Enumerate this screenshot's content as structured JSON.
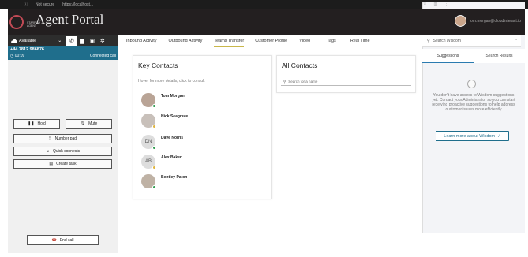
{
  "browser": {
    "security_label": "Not secure",
    "url": "https://localhost..."
  },
  "header": {
    "logo_small": "STARFISH AGENT",
    "title": "Agent Portal",
    "user_email": "tom.morgan@cloudinteract.io"
  },
  "agent": {
    "status": "Available"
  },
  "call": {
    "number": "+44 7812 986876",
    "timer": "00:09",
    "state": "Connected call"
  },
  "controls": {
    "hold": "Hold",
    "mute": "Mute",
    "number_pad": "Number pad",
    "quick_connects": "Quick connects",
    "create_task": "Create task",
    "end_call": "End call"
  },
  "tabs": [
    "Inbound Activity",
    "Outbound Activity",
    "Teams Transfer",
    "Customer Profile",
    "Video",
    "Tags",
    "Real Time"
  ],
  "active_tab": "Teams Transfer",
  "key_contacts": {
    "title": "Key Contacts",
    "hint": "Hover for more details, click to consult",
    "contacts": [
      {
        "name": "Tom Morgan",
        "initials": "",
        "status_color": "#2e9e4f"
      },
      {
        "name": "Nick Seagrave",
        "initials": "",
        "status_color": "#e0b43c"
      },
      {
        "name": "Dave Norris",
        "initials": "DN",
        "status_color": "#2e9e4f"
      },
      {
        "name": "Alex Baker",
        "initials": "AB",
        "status_color": "#e0b43c"
      },
      {
        "name": "Bentley Paton",
        "initials": "",
        "status_color": "#2e9e4f"
      }
    ]
  },
  "all_contacts": {
    "title": "All Contacts",
    "search_placeholder": "Search for a name"
  },
  "wisdom": {
    "search_placeholder": "Search Wisdom",
    "tab_suggestions": "Suggestions",
    "tab_results": "Search Results",
    "message": "You don't have access to Wisdom suggestions yet. Contact your Administrator so you can start receiving proactive suggestions to help address customer issues more efficiently",
    "learn_more": "Learn more about Wisdom"
  },
  "colors": {
    "accent": "#1f6e8c",
    "header_bg": "#231f20",
    "tab_underline": "#c9b74a"
  }
}
